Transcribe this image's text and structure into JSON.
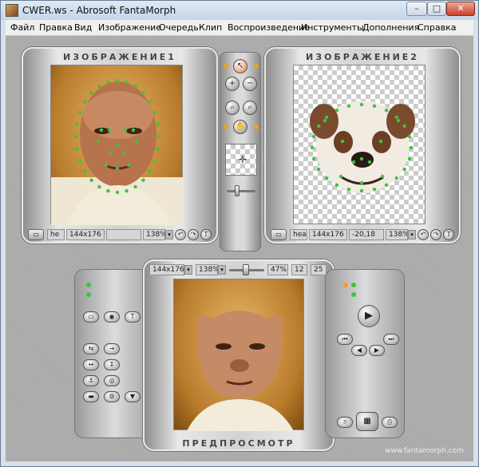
{
  "window": {
    "title": "CWER.ws - Abrosoft FantaMorph",
    "min": "–",
    "max": "□",
    "close": "✕"
  },
  "menu": [
    "Файл",
    "Правка",
    "Вид",
    "Изображение",
    "Очередь",
    "Клип",
    "Воспроизведение",
    "Инструменты",
    "Дополнения",
    "Справка"
  ],
  "image1": {
    "title": "ИЗОБРАЖЕНИЕ1",
    "name": "he",
    "size": "144x176",
    "coords": "",
    "zoom": "138%"
  },
  "image2": {
    "title": "ИЗОБРАЖЕНИЕ2",
    "name": "hea",
    "size": "144x176",
    "coords": "-20,18",
    "zoom": "138%"
  },
  "preview": {
    "title": "ПРЕДПРОСМОТР",
    "size": "144x176",
    "zoom": "138%",
    "progress": "47%",
    "frame": "12",
    "fps": "25"
  },
  "footer": {
    "url": "www.fantamorph.com"
  },
  "colors": {
    "feature_point": "#3ec43e",
    "led_orange": "#f0a020"
  }
}
